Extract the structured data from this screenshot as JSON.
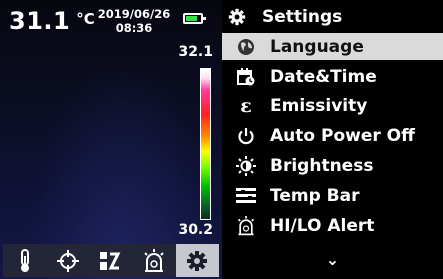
{
  "thermal": {
    "temperature": "31.1",
    "unit": "°C",
    "date": "2019/06/26",
    "time": "08:36",
    "battery_level": 0.8,
    "scale_max": "32.1",
    "scale_min": "30.2",
    "toolbar": [
      {
        "icon": "thermometer-icon"
      },
      {
        "icon": "crosshair-icon"
      },
      {
        "icon": "palette-icon"
      },
      {
        "icon": "alarm-icon"
      },
      {
        "icon": "gear-icon",
        "active": true
      }
    ]
  },
  "menu": {
    "header": "Settings",
    "items": [
      {
        "label": "Language",
        "icon": "globe-icon",
        "selected": true
      },
      {
        "label": "Date&Time",
        "icon": "calendar-clock-icon"
      },
      {
        "label": "Emissivity",
        "icon": "epsilon-icon"
      },
      {
        "label": "Auto Power Off",
        "icon": "power-icon"
      },
      {
        "label": "Brightness",
        "icon": "brightness-icon"
      },
      {
        "label": "Temp Bar",
        "icon": "temp-bar-icon"
      },
      {
        "label": "HI/LO Alert",
        "icon": "alarm-icon"
      }
    ],
    "more_indicator": "⌄"
  },
  "colors": {
    "battery_fill": "#36e04a",
    "selected_row": "#dadada",
    "toolbar_bg": "#222636",
    "toolbar_active": "#c6c8d0"
  }
}
